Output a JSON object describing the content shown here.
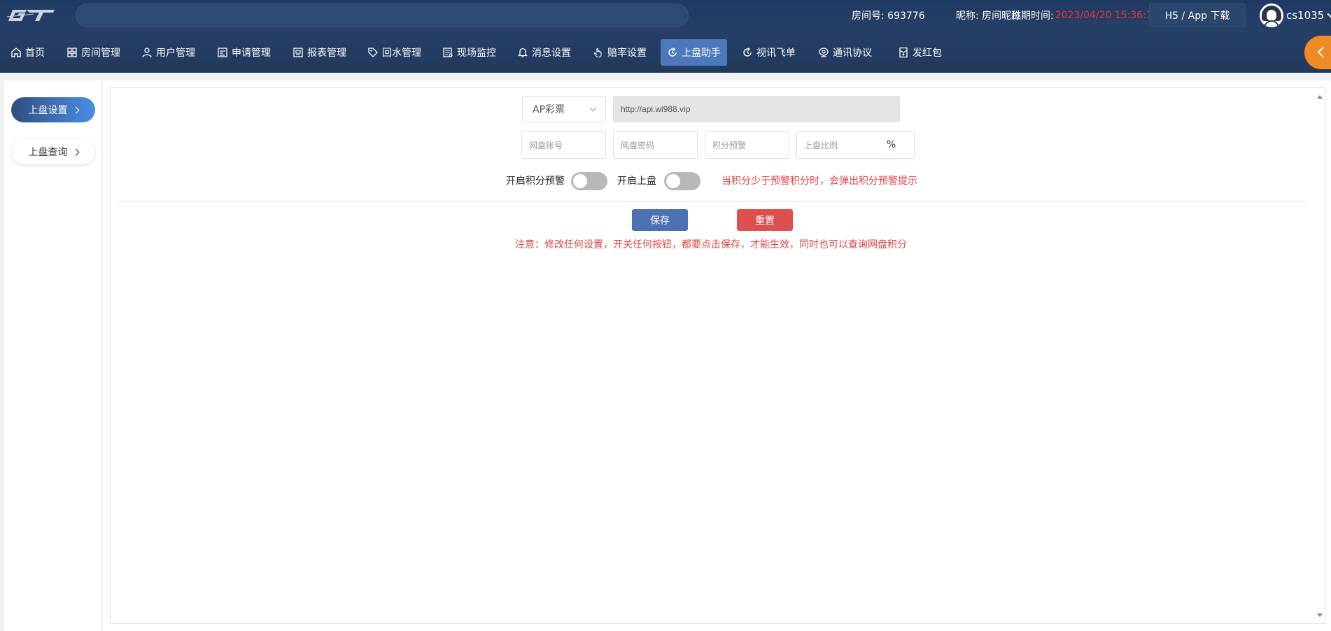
{
  "header": {
    "logo_text": "GT",
    "room_label": "房间号: 693776",
    "nick_label": "昵称: 房间昵称",
    "expire_label": "过期时间:",
    "expire_value": "2023/04/20 15:36:13",
    "h5_button": "H5 / App 下载",
    "username": "cs1035"
  },
  "nav": {
    "items": [
      {
        "label": "首页",
        "icon": "home-icon"
      },
      {
        "label": "房间管理",
        "icon": "grid-icon"
      },
      {
        "label": "用户管理",
        "icon": "user-icon"
      },
      {
        "label": "申请管理",
        "icon": "form-icon"
      },
      {
        "label": "报表管理",
        "icon": "report-icon"
      },
      {
        "label": "回水管理",
        "icon": "tag-icon"
      },
      {
        "label": "现场监控",
        "icon": "monitor-icon"
      },
      {
        "label": "消息设置",
        "icon": "bell-icon"
      },
      {
        "label": "赔率设置",
        "icon": "hand-icon"
      },
      {
        "label": "上盘助手",
        "icon": "refresh-icon"
      },
      {
        "label": "视讯飞单",
        "icon": "refresh-icon"
      },
      {
        "label": "通讯协议",
        "icon": "webcam-icon"
      },
      {
        "label": "发红包",
        "icon": "envelope-icon"
      }
    ],
    "active_index": 9
  },
  "sidebar": {
    "items": [
      {
        "label": "上盘设置"
      },
      {
        "label": "上盘查询"
      }
    ]
  },
  "form": {
    "platform_select": "AP彩票",
    "api_url": "http://api.wl988.vip",
    "account_placeholder": "网盘账号",
    "password_placeholder": "网盘密码",
    "points_warning_placeholder": "积分预警",
    "ratio_placeholder": "上盘比例",
    "ratio_unit": "%",
    "toggle_points_warning_label": "开启积分预警",
    "toggle_upload_label": "开启上盘",
    "toggle_points_warning_on": false,
    "toggle_upload_on": false,
    "warning_hint": "当积分少于预警积分时，会弹出积分预警提示",
    "save_button": "保存",
    "reset_button": "重置",
    "notice": "注意：修改任何设置，开关任何按钮，都要点击保存，才能生效，同时也可以查询网盘积分"
  },
  "colors": {
    "header_bg": "#1e3a63",
    "nav_active": "#4b79b9",
    "danger": "#e04444",
    "primary": "#4b71b1",
    "accent_orange": "#f08a24"
  }
}
